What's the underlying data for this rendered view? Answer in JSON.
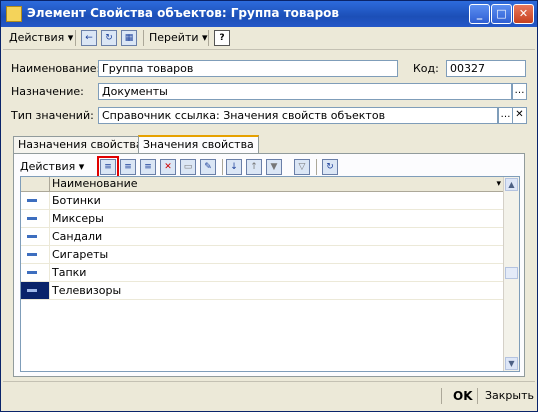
{
  "window": {
    "title": "Элемент Свойства объектов: Группа товаров"
  },
  "titlebar_buttons": {
    "minimize": "_",
    "maximize": "□",
    "close": "✕"
  },
  "toolbar": {
    "actions_label": "Действия",
    "goto_label": "Перейти",
    "help_label": "?"
  },
  "form": {
    "name_label": "Наименование:",
    "name_value": "Группа товаров",
    "code_label": "Код:",
    "code_value": "00327",
    "purpose_label": "Назначение:",
    "purpose_value": "Документы",
    "type_label": "Тип значений:",
    "type_value": "Справочник ссылка: Значения свойств объектов"
  },
  "tabs": [
    {
      "label": "Назначения свойства"
    },
    {
      "label": "Значения свойства"
    }
  ],
  "values_panel": {
    "actions_label": "Действия",
    "column_header": "Наименование",
    "rows": [
      {
        "name": "Ботинки"
      },
      {
        "name": "Миксеры"
      },
      {
        "name": "Сандали"
      },
      {
        "name": "Сигареты"
      },
      {
        "name": "Тапки"
      },
      {
        "name": "Телевизоры"
      }
    ],
    "selected_row_index": 5
  },
  "bottom": {
    "ok_label": "OK",
    "close_label": "Закрыть"
  }
}
